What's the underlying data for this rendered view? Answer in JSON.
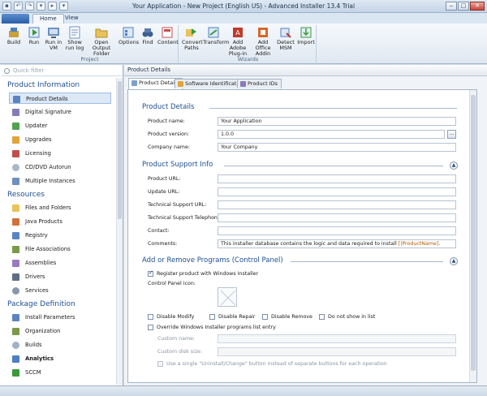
{
  "window": {
    "title": "Your Application - New Project (English US) - Advanced Installer 13.4 Trial",
    "controls": [
      "‒",
      "□",
      "✕"
    ]
  },
  "ribbon": {
    "app_menu": "",
    "tabs": [
      "Home",
      "View"
    ],
    "groups": [
      {
        "label": "Project",
        "buttons": [
          "Build",
          "Run",
          "Run in VM",
          "Show run log",
          "Open Output Folder",
          "Options",
          "Find",
          "Content"
        ]
      },
      {
        "label": "Wizards",
        "buttons": [
          "Convert Paths",
          "Transform",
          "Add Adobe Plug-in",
          "Add Office Addin",
          "Detect MSM",
          "Import"
        ]
      }
    ]
  },
  "sidebar": {
    "filter_placeholder": "Quick filter",
    "sections": [
      {
        "title": "Product Information",
        "items": [
          "Product Details",
          "Digital Signature",
          "Updater",
          "Upgrades",
          "Licensing",
          "CD/DVD Autorun",
          "Multiple Instances"
        ]
      },
      {
        "title": "Resources",
        "items": [
          "Files and Folders",
          "Java Products",
          "Registry",
          "File Associations",
          "Assemblies",
          "Drivers",
          "Services"
        ]
      },
      {
        "title": "Package Definition",
        "items": [
          "Install Parameters",
          "Organization",
          "Builds",
          "Analytics",
          "SCCM"
        ]
      }
    ]
  },
  "main": {
    "header": "Product Details",
    "tabs": [
      "Product Details",
      "Software Identification",
      "Product IDs"
    ],
    "sections": {
      "details": {
        "title": "Product Details",
        "fields": [
          {
            "label": "Product name:",
            "value": "Your Application"
          },
          {
            "label": "Product version:",
            "value": "1.0.0"
          },
          {
            "label": "Company name:",
            "value": "Your Company"
          }
        ],
        "browse": "..."
      },
      "support": {
        "title": "Product Support Info",
        "fields": [
          {
            "label": "Product URL:",
            "value": ""
          },
          {
            "label": "Update URL:",
            "value": ""
          },
          {
            "label": "Technical Support URL:",
            "value": ""
          },
          {
            "label": "Technical Support Telephone:",
            "value": ""
          },
          {
            "label": "Contact:",
            "value": ""
          },
          {
            "label": "Comments:",
            "value_prefix": "This installer database contains the logic and data required to install ",
            "value_token": "[|ProductName]",
            "value_suffix": "."
          }
        ]
      },
      "arp": {
        "title": "Add or Remove Programs (Control Panel)",
        "register_label": "Register product with Windows Installer",
        "icon_label": "Control Panel icon:",
        "options": [
          "Disable Modify",
          "Disable Repair",
          "Disable Remove",
          "Do not show in list"
        ],
        "override_label": "Override Windows Installer programs list entry",
        "custom_name_label": "Custom name:",
        "custom_disk_label": "Custom disk size:",
        "single_button_label": "Use a single \"Uninstall/Change\" button instead of separate buttons for each operation"
      }
    }
  },
  "colors": {
    "accent": "#1d4f91",
    "selected": "#dce8f6"
  }
}
